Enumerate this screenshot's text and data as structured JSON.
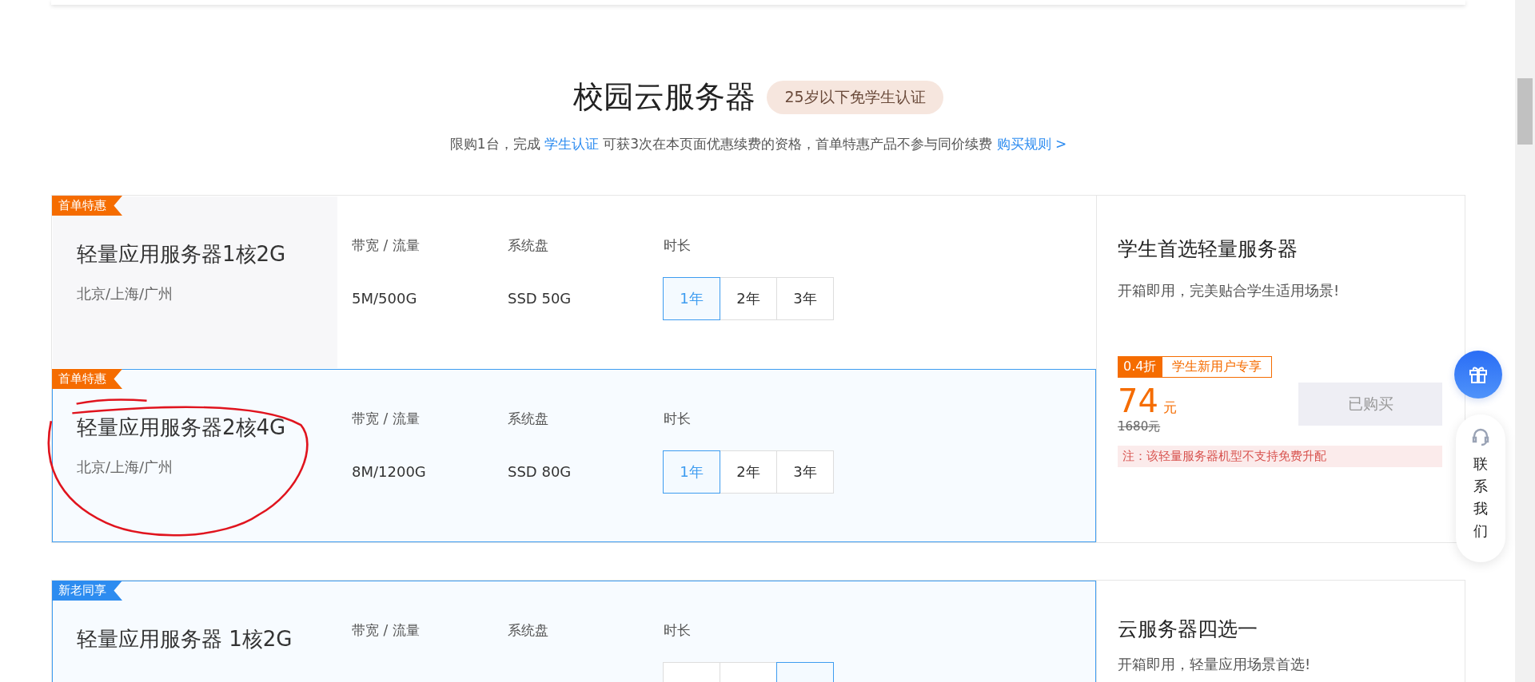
{
  "header": {
    "title": "校园云服务器",
    "badge": "25岁以下免学生认证"
  },
  "notice": {
    "text_before": "限购1台，完成",
    "link": "学生认证",
    "text_after": "可获3次在本页面优惠续费的资格，首单特惠产品不参与同价续费",
    "rules_link": "购买规则 >"
  },
  "sections": [
    {
      "products": [
        {
          "tag": "首单特惠",
          "color": "#f56c00",
          "name": "轻量应用服务器1核2G",
          "regions": "北京/上海/广州",
          "selected": false,
          "specs": [
            {
              "label": "带宽 / 流量",
              "value": "5M/500G"
            },
            {
              "label": "系统盘",
              "value": "SSD 50G"
            }
          ],
          "duration_label": "时长",
          "durations": [
            {
              "label": "1年",
              "selected": true
            },
            {
              "label": "2年",
              "selected": false
            },
            {
              "label": "3年",
              "selected": false
            }
          ]
        },
        {
          "tag": "首单特惠",
          "color": "#f56c00",
          "name": "轻量应用服务器2核4G",
          "regions": "北京/上海/广州",
          "selected": true,
          "specs": [
            {
              "label": "带宽 / 流量",
              "value": "8M/1200G"
            },
            {
              "label": "系统盘",
              "value": "SSD 80G"
            }
          ],
          "duration_label": "时长",
          "durations": [
            {
              "label": "1年",
              "selected": true
            },
            {
              "label": "2年",
              "selected": false
            },
            {
              "label": "3年",
              "selected": false
            }
          ]
        }
      ],
      "panel": {
        "title": "学生首选轻量服务器",
        "desc": "开箱即用，完美贴合学生适用场景!",
        "discount": "0.4折",
        "discount_label": "学生新用户专享",
        "price": "74",
        "unit": "元",
        "original_price": "1680元",
        "button": {
          "label": "已购买",
          "disabled": true
        },
        "note": "注：该轻量服务器机型不支持免费升配"
      }
    },
    {
      "products": [
        {
          "tag": "新老同享",
          "color": "#2d8cf0",
          "name": "轻量应用服务器 1核2G",
          "selected": true,
          "specs": [
            {
              "label": "带宽 / 流量"
            },
            {
              "label": "系统盘"
            }
          ],
          "duration_label": "时长",
          "durations": [
            {
              "selected": false
            },
            {
              "selected": false
            },
            {
              "selected": true
            }
          ]
        }
      ],
      "panel": {
        "title": "云服务器四选一",
        "desc": "开箱即用，轻量应用场景首选!"
      }
    }
  ],
  "float": {
    "contact": "联系我们"
  }
}
